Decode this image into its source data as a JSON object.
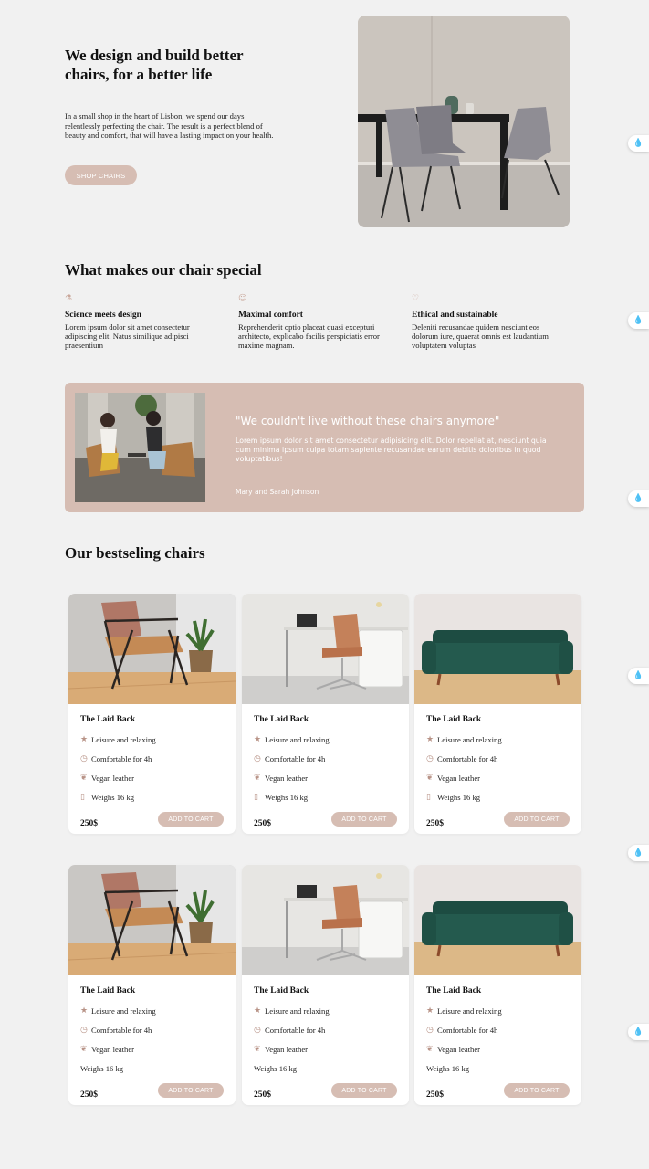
{
  "hero": {
    "title": "We design and build better chairs, for a better life",
    "text": "In a small shop in the heart of Lisbon, we spend our days relentlessly perfecting the chair. The result is a perfect blend of beauty and comfort, that will have a lasting impact on your health.",
    "cta": "SHOP CHAIRS"
  },
  "features": {
    "title": "What makes our chair special",
    "items": [
      {
        "icon": "flask-icon",
        "title": "Science meets design",
        "text": "Lorem ipsum dolor sit amet consectetur adipiscing elit. Natus similique adipisci praesentium"
      },
      {
        "icon": "smile-icon",
        "title": "Maximal comfort",
        "text": "Reprehenderit optio placeat quasi excepturi architecto, explicabo facilis perspiciatis error maxime magnam."
      },
      {
        "icon": "heart-icon",
        "title": "Ethical and sustainable",
        "text": "Deleniti recusandae quidem nesciunt eos dolorum iure, quaerat omnis est laudantium voluptatem voluptas"
      }
    ]
  },
  "testimonial": {
    "quote": "\"We couldn't live without these chairs anymore\"",
    "text": "Lorem ipsum dolor sit amet consectetur adipisicing elit. Dolor repellat at, nesciunt quia cum minima ipsum culpa totam sapiente recusandae earum debitis doloribus in quod voluptatibus!",
    "author": "Mary and Sarah Johnson"
  },
  "bestsellers": {
    "title": "Our bestseling chairs",
    "cards": [
      {
        "name": "The Laid Back",
        "attrs": [
          "Leisure and relaxing",
          "Comfortable for 4h",
          "Vegan leather",
          "Weighs 16 kg"
        ],
        "price": "250$",
        "cta": "ADD TO CART"
      },
      {
        "name": "The Laid Back",
        "attrs": [
          "Leisure and relaxing",
          "Comfortable for 4h",
          "Vegan leather",
          "Weighs 16 kg"
        ],
        "price": "250$",
        "cta": "ADD TO CART"
      },
      {
        "name": "The Laid Back",
        "attrs": [
          "Leisure and relaxing",
          "Comfortable for 4h",
          "Vegan leather",
          "Weighs 16 kg"
        ],
        "price": "250$",
        "cta": "ADD TO CART"
      },
      {
        "name": "The Laid Back",
        "attrs": [
          "Leisure and relaxing",
          "Comfortable for 4h",
          "Vegan leather",
          "Weighs 16 kg"
        ],
        "price": "250$",
        "cta": "ADD TO CART"
      },
      {
        "name": "The Laid Back",
        "attrs": [
          "Leisure and relaxing",
          "Comfortable for 4h",
          "Vegan leather",
          "Weighs 16 kg"
        ],
        "price": "250$",
        "cta": "ADD TO CART"
      },
      {
        "name": "The Laid Back",
        "attrs": [
          "Leisure and relaxing",
          "Comfortable for 4h",
          "Vegan leather",
          "Weighs 16 kg"
        ],
        "price": "250$",
        "cta": "ADD TO CART"
      }
    ]
  },
  "side_widget": {
    "icon": "water-drop-icon"
  },
  "colors": {
    "accent": "#d6bdb3",
    "background": "#f1f1f1",
    "widget": "#2aa6dc"
  }
}
